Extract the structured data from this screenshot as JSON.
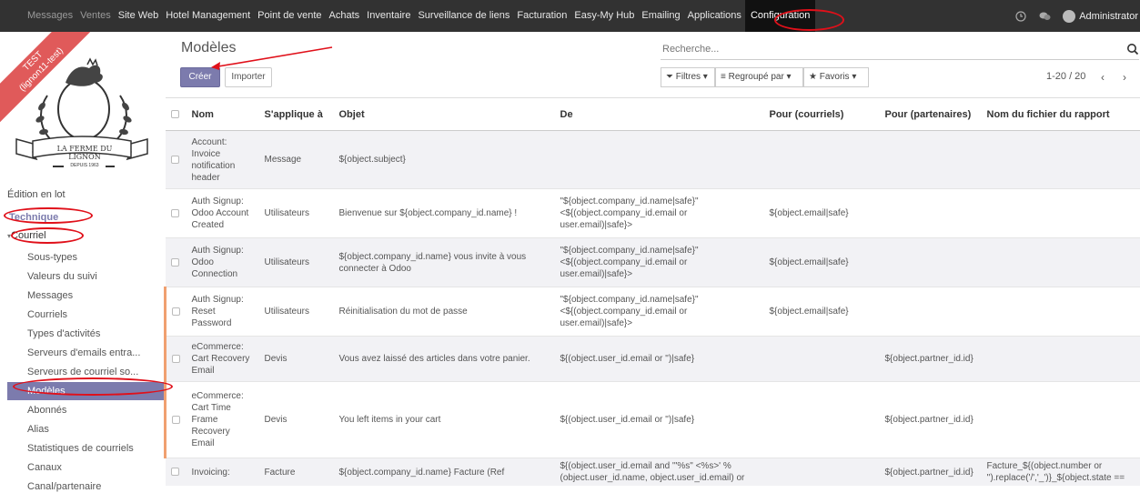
{
  "topbar": {
    "menu": [
      {
        "label": "Messages",
        "dim": true
      },
      {
        "label": "Ventes",
        "dim": true
      },
      {
        "label": "Site Web"
      },
      {
        "label": "Hotel Management"
      },
      {
        "label": "Point de vente"
      },
      {
        "label": "Achats"
      },
      {
        "label": "Inventaire"
      },
      {
        "label": "Surveillance de liens"
      },
      {
        "label": "Facturation"
      },
      {
        "label": "Easy-My Hub"
      },
      {
        "label": "Emailing"
      },
      {
        "label": "Applications"
      },
      {
        "label": "Configuration",
        "active": true
      }
    ],
    "user": "Administrator"
  },
  "sidebar": {
    "ribbon_line1": "TEST",
    "ribbon_line2": "(lignon11-test)",
    "logo_text": "LA FERME DU LIGNON",
    "logo_sub": "DEPUIS 1963",
    "batch_edit": "Édition en lot",
    "section": "Technique",
    "subsection": "Courriel",
    "items": [
      "Sous-types",
      "Valeurs du suivi",
      "Messages",
      "Courriels",
      "Types d'activités",
      "Serveurs d'emails entra...",
      "Serveurs de courriel so...",
      "Modèles",
      "Abonnés",
      "Alias",
      "Statistiques de courriels",
      "Canaux",
      "Canal/partenaire"
    ],
    "active_index": 7
  },
  "control": {
    "title": "Modèles",
    "create": "Créer",
    "import": "Importer",
    "search_placeholder": "Recherche...",
    "filters": "Filtres",
    "group_by": "Regroupé par",
    "favorites": "Favoris",
    "pager": "1-20 / 20"
  },
  "table": {
    "columns": [
      "Nom",
      "S'applique à",
      "Objet",
      "De",
      "Pour (courriels)",
      "Pour (partenaires)",
      "Nom du fichier du rapport"
    ],
    "rows": [
      {
        "name": "Account: Invoice notification header",
        "applies": "Message",
        "object": "${object.subject}",
        "from": "",
        "to_email": "",
        "to_partner": "",
        "report": ""
      },
      {
        "name": "Auth Signup: Odoo Account Created",
        "applies": "Utilisateurs",
        "object": "Bienvenue sur ${object.company_id.name} !",
        "from": "\"${object.company_id.name|safe}\" <${(object.company_id.email or user.email)|safe}>",
        "to_email": "${object.email|safe}",
        "to_partner": "",
        "report": ""
      },
      {
        "name": "Auth Signup: Odoo Connection",
        "applies": "Utilisateurs",
        "object": "${object.company_id.name} vous invite à vous connecter à Odoo",
        "from": "\"${object.company_id.name|safe}\" <${(object.company_id.email or user.email)|safe}>",
        "to_email": "${object.email|safe}",
        "to_partner": "",
        "report": ""
      },
      {
        "name": "Auth Signup: Reset Password",
        "applies": "Utilisateurs",
        "object": "Réinitialisation du mot de passe",
        "from": "\"${object.company_id.name|safe}\" <${(object.company_id.email or user.email)|safe}>",
        "to_email": "${object.email|safe}",
        "to_partner": "",
        "report": ""
      },
      {
        "name": "eCommerce: Cart Recovery Email",
        "applies": "Devis",
        "object": "Vous avez laissé des articles dans votre panier.",
        "from": "${(object.user_id.email or '')|safe}",
        "to_email": "",
        "to_partner": "${object.partner_id.id}",
        "report": ""
      },
      {
        "name": "eCommerce: Cart Time Frame Recovery Email",
        "applies": "Devis",
        "object": "You left items in your cart",
        "from": "${(object.user_id.email or '')|safe}",
        "to_email": "",
        "to_partner": "${object.partner_id.id}",
        "report": ""
      },
      {
        "name": "Invoicing:",
        "applies": "Facture",
        "object": "${object.company_id.name} Facture (Ref",
        "from": "${(object.user_id.email and '\"%s\" <%s>' % (object.user_id.name, object.user_id.email) or",
        "to_email": "",
        "to_partner": "${object.partner_id.id}",
        "report": "Facture_${(object.number or '').replace('/','_')}_${object.state =="
      }
    ]
  }
}
